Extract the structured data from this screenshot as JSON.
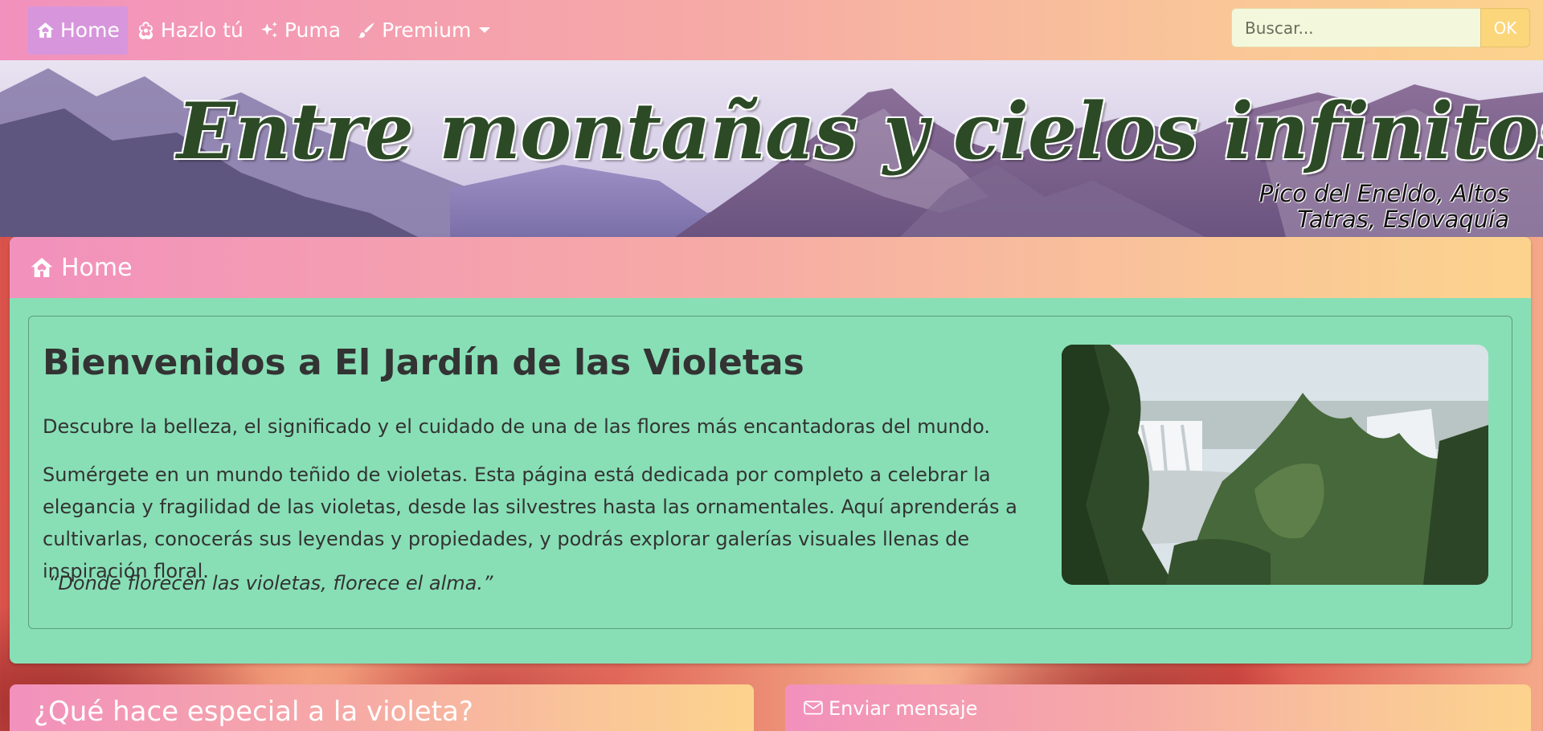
{
  "nav": {
    "items": [
      {
        "label": "Home",
        "icon": "home-icon",
        "active": true
      },
      {
        "label": "Hazlo tú",
        "icon": "flower-icon"
      },
      {
        "label": "Puma",
        "icon": "sparkles-icon"
      },
      {
        "label": "Premium",
        "icon": "brush-icon",
        "dropdown": true
      }
    ],
    "search_placeholder": "Buscar...",
    "search_button": "OK"
  },
  "banner": {
    "title": "Entre montañas y cielos infinitos",
    "caption_line1": "Pico del Eneldo, Altos",
    "caption_line2": "Tatras, Eslovaquia"
  },
  "home": {
    "header": "Home",
    "title": "Bienvenidos a El Jardín de las Violetas",
    "intro": "Descubre la belleza, el significado y el cuidado de una de las flores más encantadoras del mundo.",
    "body": "Sumérgete en un mundo teñido de violetas. Esta página está dedicada por completo a celebrar la elegancia y fragilidad de las violetas, desde las silvestres hasta las ornamentales. Aquí aprenderás a cultivarlas, conocerás sus leyendas y propiedades, y podrás explorar galerías visuales llenas de inspiración floral.",
    "quote": "“Donde florecen las violetas, florece el alma.”"
  },
  "cards": {
    "violet_title": "¿Qué hace especial a la violeta?",
    "message_title": "Enviar mensaje"
  },
  "colors": {
    "header_gradient_start": "#f291bd",
    "header_gradient_end": "#fcd38d",
    "home_background": "#88dfb6",
    "active_nav": "#d796dc",
    "banner_title": "#2b4a25"
  }
}
